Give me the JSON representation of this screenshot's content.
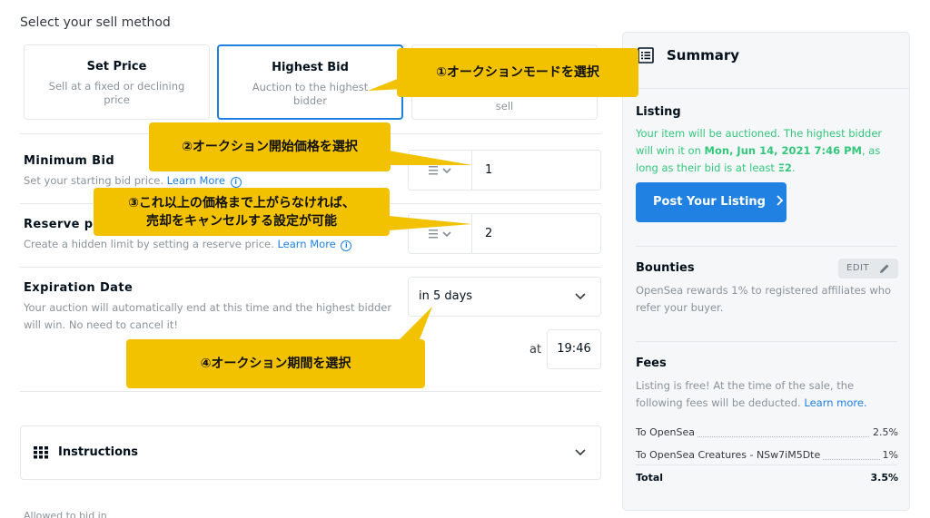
{
  "section_title": "Select your sell method",
  "methods": [
    {
      "title": "Set Price",
      "desc": "Sell at a fixed or declining price"
    },
    {
      "title": "Highest Bid",
      "desc": "Auction to the highest bidder"
    },
    {
      "desc_partial": "sell"
    }
  ],
  "minimum_bid": {
    "label": "Minimum Bid",
    "desc": "Set your starting bid price.",
    "link": "Learn More",
    "currency_icon": "ethereum-icon",
    "value": "1"
  },
  "reserve_price": {
    "label": "Reserve pr",
    "desc": "Create a hidden limit by setting a reserve price.",
    "link": "Learn More",
    "currency_icon": "ethereum-icon",
    "value": "2"
  },
  "expiration": {
    "label": "Expiration Date",
    "desc": "Your auction will automatically end at this time and the highest bidder will win. No need to cancel it!",
    "selected": "in 5 days",
    "at_label": "at",
    "time": "19:46"
  },
  "instructions": {
    "label": "Instructions"
  },
  "bottom_cut_text": "Allowed to bid in",
  "summary": {
    "title": "Summary",
    "listing": {
      "title": "Listing",
      "text_1": "Your item will be auctioned. The highest bidder will win it on",
      "date": "Mon, Jun 14, 2021 7:46 PM",
      "text_2": ", as long as their bid is at least",
      "min": "Ξ2",
      "text_3": "."
    },
    "post_button": "Post Your Listing",
    "bounties": {
      "title": "Bounties",
      "edit": "EDIT",
      "desc": "OpenSea rewards 1% to registered affiliates who refer your buyer."
    },
    "fees": {
      "title": "Fees",
      "desc": "Listing is free! At the time of the sale, the following fees will be deducted.",
      "link": "Learn more.",
      "rows": [
        {
          "name": "To OpenSea",
          "pct": "2.5%"
        },
        {
          "name": "To OpenSea Creatures - NSw7iM5Dte",
          "pct": "1%"
        }
      ],
      "total_label": "Total",
      "total_pct": "3.5%"
    }
  },
  "callouts": {
    "c1": "①オークションモードを選択",
    "c2": "②オークション開始価格を選択",
    "c3_line1": "③これ以上の価格まで上がらなければ、",
    "c3_line2": "売却をキャンセルする設定が可能",
    "c4": "④オークション期間を選択"
  },
  "colors": {
    "accent": "#2081e2",
    "success": "#34c77b",
    "callout": "#f2c200",
    "panel_bg": "#f5f7f9",
    "border": "#e5e8eb"
  }
}
